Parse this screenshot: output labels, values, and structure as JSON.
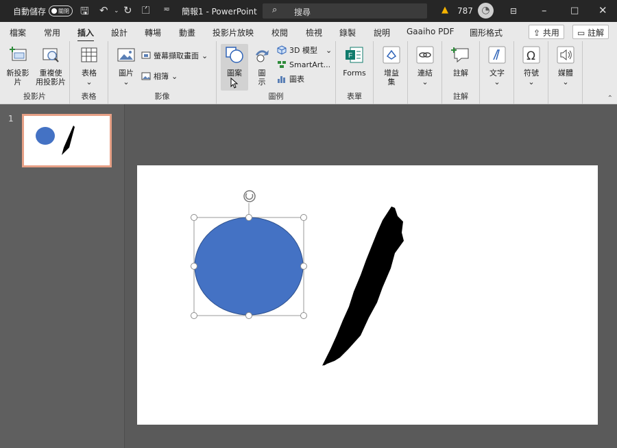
{
  "titlebar": {
    "autosave_label": "自動儲存",
    "autosave_state": "關閉",
    "document_title": "簡報1 - PowerPoint",
    "search_placeholder": "搜尋",
    "notification_count": "787"
  },
  "tabs": [
    "檔案",
    "常用",
    "插入",
    "設計",
    "轉場",
    "動畫",
    "投影片放映",
    "校閱",
    "檢視",
    "錄製",
    "說明",
    "Gaaiho PDF",
    "圖形格式"
  ],
  "active_tab": "插入",
  "actions": {
    "share": "共用",
    "comment": "註解"
  },
  "ribbon": {
    "groups": {
      "slides": "投影片",
      "tables": "表格",
      "images": "影像",
      "illustrations": "圖例",
      "forms": "表單",
      "comments": "註解"
    },
    "items": {
      "new_slide": [
        "新投影",
        "片"
      ],
      "reuse_slides": [
        "重複使",
        "用投影片"
      ],
      "table": "表格",
      "pictures": "圖片",
      "screenshot": "螢幕擷取畫面",
      "album": "相簿",
      "shapes": "圖案",
      "icons": [
        "圖",
        "示"
      ],
      "models_3d": "3D 模型",
      "smartart": "SmartArt...",
      "chart": "圖表",
      "forms": "Forms",
      "addins": [
        "增益",
        "集"
      ],
      "links": "連結",
      "comment": "註解",
      "text": "文字",
      "symbols": "符號",
      "media": "媒體"
    }
  },
  "slide_panel": {
    "slide_number": "1"
  },
  "colors": {
    "accent_ellipse": "#4472c4",
    "thumb_border": "#e7a086",
    "titlebar_bg": "#262626",
    "ribbon_bg": "#e9e9e9"
  }
}
